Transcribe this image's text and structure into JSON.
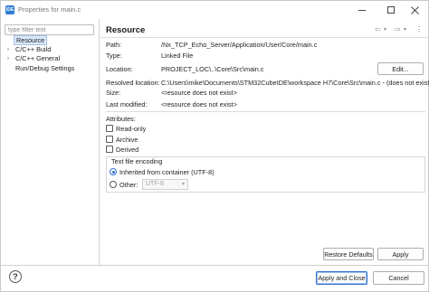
{
  "window": {
    "title": "Properties for main.c",
    "app_icon_text": "IDE"
  },
  "filter": {
    "placeholder": "type filter text",
    "value": ""
  },
  "tree": [
    {
      "label": "Resource",
      "arrow": "",
      "selected": true
    },
    {
      "label": "C/C++ Build",
      "arrow": "›",
      "selected": false
    },
    {
      "label": "C/C++ General",
      "arrow": "›",
      "selected": false
    },
    {
      "label": "Run/Debug Settings",
      "arrow": "",
      "selected": false
    }
  ],
  "page": {
    "title": "Resource"
  },
  "nav": {
    "back": "⇦",
    "back_menu": "▾",
    "forward": "⇨",
    "forward_menu": "▾",
    "menu": "⋮"
  },
  "props": {
    "path_label": "Path:",
    "path_value": "/Nx_TCP_Echo_Server/Application/User/Core/main.c",
    "type_label": "Type:",
    "type_value": "Linked File",
    "location_label": "Location:",
    "location_value": "PROJECT_LOC\\..\\Core\\Src\\main.c",
    "edit_label": "Edit...",
    "resolved_label": "Resolved location:",
    "resolved_value": "C:\\Users\\mike\\Documents\\STM32CubeIDE\\workspace H7\\Core\\Src\\main.c - (does not exist)",
    "size_label": "Size:",
    "size_value": "<resource does not exist>",
    "modified_label": "Last modified:",
    "modified_value": "<resource does not exist>"
  },
  "attributes": {
    "title": "Attributes:",
    "read_only": "Read-only",
    "archive": "Archive",
    "derived": "Derived"
  },
  "encoding": {
    "title": "Text file encoding",
    "inherited": "Inherited from container (UTF-8)",
    "other": "Other:",
    "other_value": "UTF-8"
  },
  "buttons": {
    "restore_defaults": "Restore Defaults",
    "apply": "Apply",
    "apply_and_close": "Apply and Close",
    "cancel": "Cancel",
    "help": "?"
  }
}
